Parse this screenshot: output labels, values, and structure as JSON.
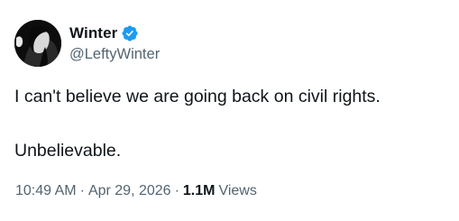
{
  "author": {
    "display_name": "Winter",
    "handle": "@LeftyWinter",
    "verified": true
  },
  "tweet": {
    "line1": "I can't believe we are going back on civil rights.",
    "line2": "Unbelievable."
  },
  "meta": {
    "time": "10:49 AM",
    "separator": "·",
    "date": "Apr 29, 2026",
    "views_count": "1.1M",
    "views_label": "Views"
  },
  "icons": {
    "verified": "verified-badge-icon"
  },
  "colors": {
    "verified_blue": "#1d9bf0",
    "text_primary": "#0f1419",
    "text_secondary": "#536471"
  }
}
